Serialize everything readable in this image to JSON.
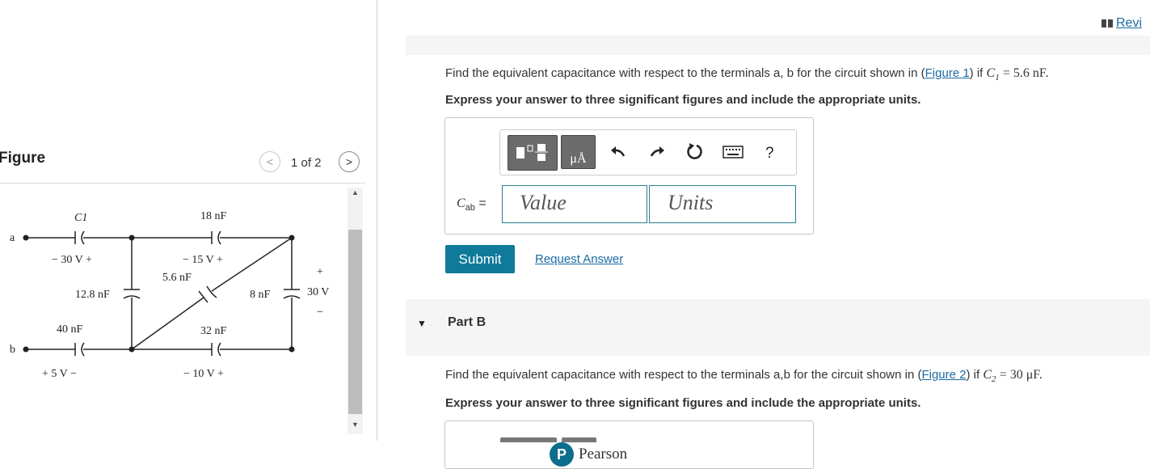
{
  "figure_panel": {
    "title": "Figure",
    "page_indicator": "1 of 2",
    "prev_symbol": "<",
    "next_symbol": ">",
    "circuit_labels": {
      "node_a": "a",
      "node_b": "b",
      "c1": "C1",
      "c1_voltage": "− 30 V +",
      "c_18nF": "18 nF",
      "c_18nF_voltage": "− 15 V +",
      "c_5_6nF": "5.6 nF",
      "c_12_8nF": "12.8 nF",
      "c_8nF": "8 nF",
      "c_8nF_voltage_plus": "+",
      "c_8nF_voltage": "30 V",
      "c_8nF_voltage_minus": "−",
      "c_40nF": "40 nF",
      "c_40nF_voltage": "+ 5 V −",
      "c_32nF": "32 nF",
      "c_32nF_voltage": "− 10 V +"
    }
  },
  "header": {
    "review_label": "Revi"
  },
  "part_a": {
    "question_prefix": "Find the equivalent capacitance with respect to the terminals a, b for the circuit shown in (",
    "figure_link": "Figure 1",
    "question_mid": ") if ",
    "c1_value": "= 5.6 nF.",
    "instruction": "Express your answer to three significant figures and include the appropriate units.",
    "answer_label": "= ",
    "value_placeholder": "Value",
    "units_placeholder": "Units",
    "toolbar": {
      "units_button_text": "μÅ",
      "help_symbol": "?"
    },
    "submit_label": "Submit",
    "request_label": "Request Answer"
  },
  "part_b": {
    "label": "Part B",
    "question_prefix": "Find the equivalent capacitance with respect to the terminals a,b for the circuit shown in (",
    "figure_link": "Figure 2",
    "question_mid": ") if ",
    "c2_value": "= 30 μF.",
    "instruction": "Express your answer to three significant figures and include the appropriate units."
  },
  "footer": {
    "brand": "Pearson",
    "brand_initial": "P"
  }
}
